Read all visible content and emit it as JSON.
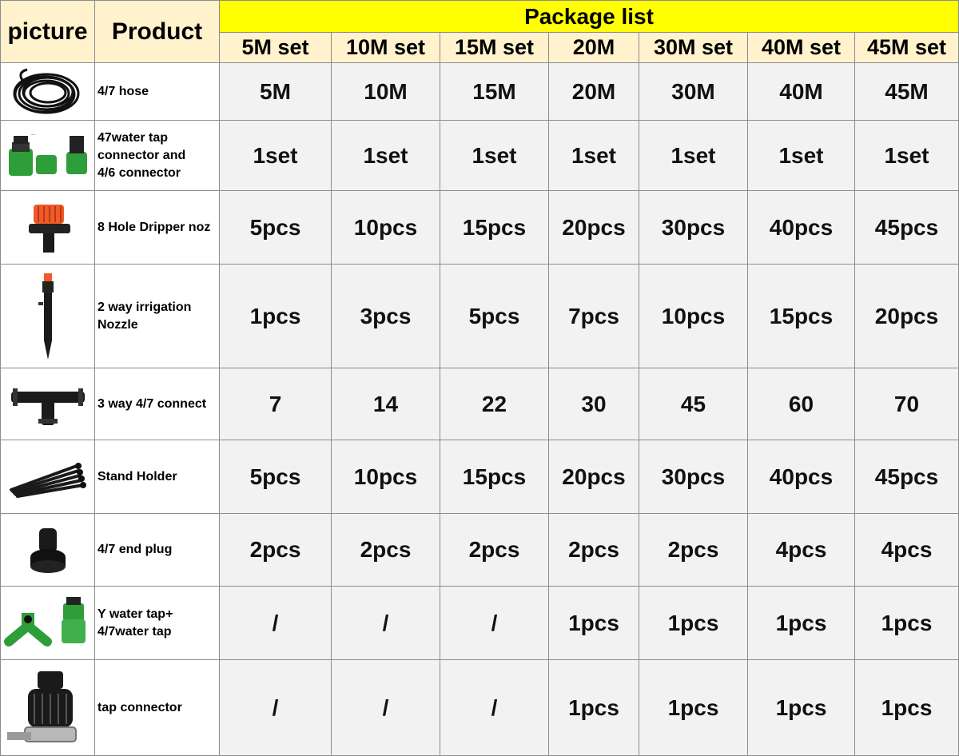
{
  "header": {
    "picture": "picture",
    "product": "Product",
    "title": "Package list",
    "sets": [
      "5M set",
      "10M set",
      "15M set",
      "20M",
      "30M set",
      "40M set",
      "45M set"
    ]
  },
  "rows": [
    {
      "icon": "hose-icon",
      "product_lines": [
        "4/7 hose"
      ],
      "values": [
        "5M",
        "10M",
        "15M",
        "20M",
        "30M",
        "40M",
        "45M"
      ]
    },
    {
      "icon": "tap-connector-set-icon",
      "product_lines": [
        "47water tap",
        "connector and",
        "4/6 connector"
      ],
      "values": [
        "1set",
        "1set",
        "1set",
        "1set",
        "1set",
        "1set",
        "1set"
      ]
    },
    {
      "icon": "dripper-icon",
      "product_lines": [
        "8 Hole Dripper noz"
      ],
      "values": [
        "5pcs",
        "10pcs",
        "15pcs",
        "20pcs",
        "30pcs",
        "40pcs",
        "45pcs"
      ]
    },
    {
      "icon": "nozzle-stake-icon",
      "product_lines": [
        "2 way irrigation",
        "Nozzle"
      ],
      "values": [
        "1pcs",
        "3pcs",
        "5pcs",
        "7pcs",
        "10pcs",
        "15pcs",
        "20pcs"
      ]
    },
    {
      "icon": "tee-connector-icon",
      "product_lines": [
        "3 way 4/7 connect"
      ],
      "values": [
        "7",
        "14",
        "22",
        "30",
        "45",
        "60",
        "70"
      ]
    },
    {
      "icon": "stand-holder-icon",
      "product_lines": [
        "Stand Holder"
      ],
      "values": [
        "5pcs",
        "10pcs",
        "15pcs",
        "20pcs",
        "30pcs",
        "40pcs",
        "45pcs"
      ]
    },
    {
      "icon": "end-plug-icon",
      "product_lines": [
        "4/7 end plug"
      ],
      "values": [
        "2pcs",
        "2pcs",
        "2pcs",
        "2pcs",
        "2pcs",
        "4pcs",
        "4pcs"
      ]
    },
    {
      "icon": "y-tap-icon",
      "product_lines": [
        "Y water tap+",
        "4/7water tap"
      ],
      "values": [
        "/",
        "/",
        "/",
        "1pcs",
        "1pcs",
        "1pcs",
        "1pcs"
      ]
    },
    {
      "icon": "tap-adapter-icon",
      "product_lines": [
        "tap connector"
      ],
      "values": [
        "/",
        "/",
        "/",
        "1pcs",
        "1pcs",
        "1pcs",
        "1pcs"
      ]
    }
  ],
  "colors": {
    "title_fill": "#ffff00",
    "header_fill": "#fff2cc",
    "value_fill": "#f2f2f2",
    "grid": "#8c8c8c",
    "green_part": "#2e9e3a",
    "orange_part": "#f05a28"
  }
}
